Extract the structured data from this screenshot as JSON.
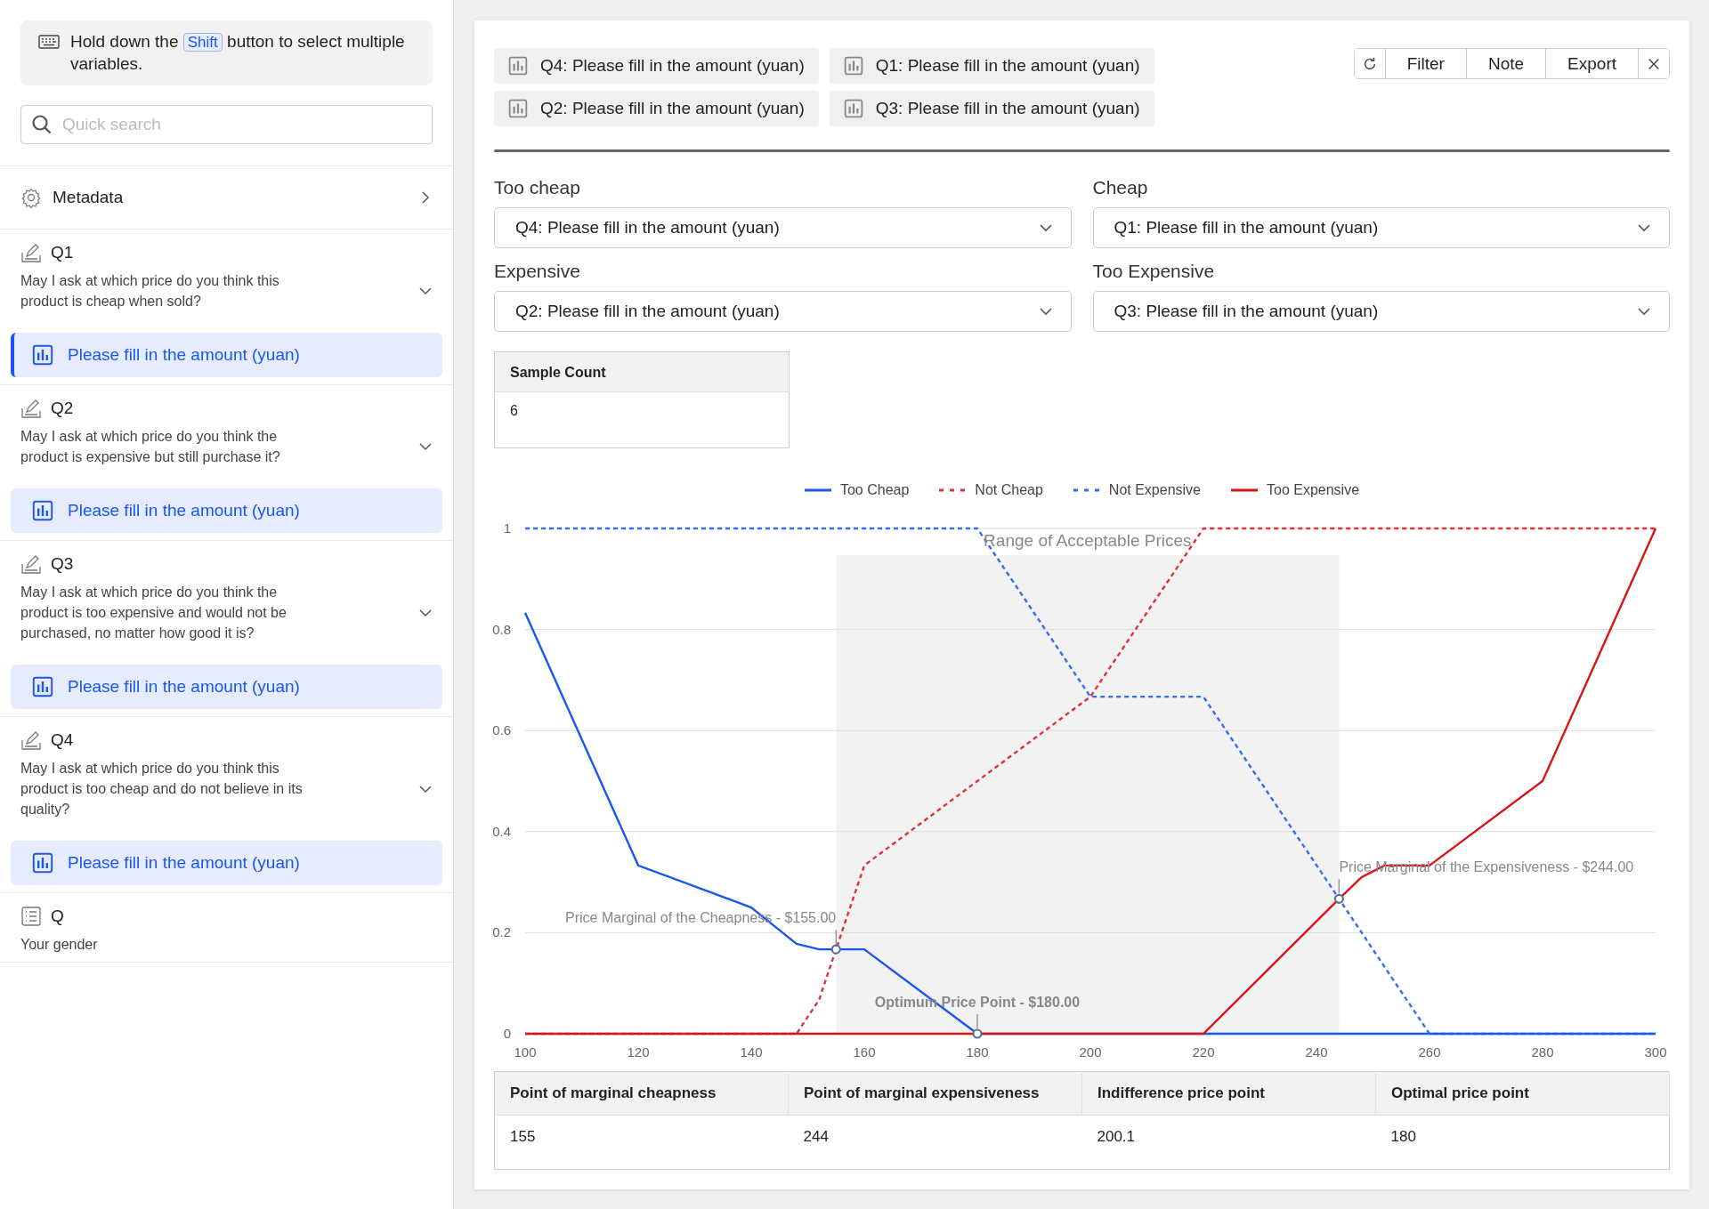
{
  "sidebar": {
    "hint": {
      "before": "Hold down the",
      "key": "Shift",
      "after": "button to select multiple variables."
    },
    "search": {
      "placeholder": "Quick search"
    },
    "items": [
      {
        "kind": "metadata",
        "label": "Metadata"
      },
      {
        "kind": "fill_in",
        "label": "Q1",
        "question": "May I ask at which price do you think this product is cheap when sold?",
        "variables": [
          {
            "label": "Please fill in the amount (yuan)",
            "selected": true
          }
        ]
      },
      {
        "kind": "fill_in",
        "label": "Q2",
        "question": "May I ask at which price do you think the product is expensive but still purchase it?",
        "variables": [
          {
            "label": "Please fill in the amount (yuan)",
            "selected": false
          }
        ]
      },
      {
        "kind": "fill_in",
        "label": "Q3",
        "question": "May I ask at which price do you think the product is too expensive and would not be purchased, no matter how good it is?",
        "variables": [
          {
            "label": "Please fill in the amount (yuan)",
            "selected": false
          }
        ]
      },
      {
        "kind": "fill_in",
        "label": "Q4",
        "question": "May I ask at which price do you think this product is too cheap and do not believe in its quality?",
        "variables": [
          {
            "label": "Please fill in the amount (yuan)",
            "selected": false
          }
        ]
      },
      {
        "kind": "choice",
        "label": "Q",
        "question": "Your gender"
      }
    ]
  },
  "main": {
    "selected_variables": [
      "Q4: Please fill in the amount (yuan)",
      "Q1: Please fill in the amount (yuan)",
      "Q2: Please fill in the amount (yuan)",
      "Q3: Please fill in the amount (yuan)"
    ],
    "toolbar": [
      "Filter",
      "Note",
      "Export"
    ],
    "mappings": [
      {
        "label": "Too cheap",
        "value": "Q4: Please fill in the amount (yuan)"
      },
      {
        "label": "Cheap",
        "value": "Q1: Please fill in the amount (yuan)"
      },
      {
        "label": "Expensive",
        "value": "Q2: Please fill in the amount (yuan)"
      },
      {
        "label": "Too Expensive",
        "value": "Q3: Please fill in the amount (yuan)"
      }
    ],
    "sample_table": {
      "columns": [
        "Sample Count"
      ],
      "rows": [
        [
          "6"
        ]
      ]
    },
    "chart": {
      "chart_data": {
        "type": "line",
        "x": [
          100,
          120,
          140,
          148,
          152,
          155,
          160,
          180,
          200,
          220,
          244,
          248,
          252,
          260,
          280,
          300
        ],
        "series": [
          {
            "name": "Too Cheap",
            "color": "#1a56f0",
            "line_style": "solid",
            "values": [
              0.833,
              0.333,
              0.25,
              0.178,
              0.167,
              0.167,
              0.167,
              0,
              0,
              0,
              0,
              0,
              0,
              0,
              0,
              0
            ]
          },
          {
            "name": "Not Cheap",
            "color": "#e0323a",
            "line_style": "dashed",
            "values": [
              0,
              0,
              0,
              0,
              0.067,
              0.167,
              0.333,
              0.5,
              0.667,
              1,
              1,
              1,
              1,
              1,
              1,
              1
            ]
          },
          {
            "name": "Not Expensive",
            "color": "#2f6ef5",
            "line_style": "dashed",
            "values": [
              1,
              1,
              1,
              1,
              1,
              1,
              1,
              1,
              0.667,
              0.667,
              0.267,
              0.2,
              0.133,
              0,
              0,
              0
            ]
          },
          {
            "name": "Too Expensive",
            "color": "#d91414",
            "line_style": "solid",
            "values": [
              0,
              0,
              0,
              0,
              0,
              0,
              0,
              0,
              0,
              0,
              0.267,
              0.31,
              0.333,
              0.333,
              0.5,
              1
            ]
          }
        ],
        "xlim": [
          100,
          300
        ],
        "ylim": [
          0,
          1
        ],
        "xticks": [
          100,
          120,
          140,
          160,
          180,
          200,
          220,
          240,
          260,
          280,
          300
        ],
        "yticks": [
          0,
          0.2,
          0.4,
          0.6,
          0.8,
          1
        ],
        "grid": true,
        "bands": [
          {
            "axis": "x",
            "from": 155,
            "to": 244,
            "label": "Range of Acceptable Prices"
          }
        ],
        "annotations": [
          {
            "x": 155,
            "y": 0.167,
            "text": "Price Marginal of the Cheapness - $155.00"
          },
          {
            "x": 180,
            "y": 0,
            "text": "Optimum Price Point - $180.00"
          },
          {
            "x": 244,
            "y": 0.267,
            "text": "Price Marginal of the Expensiveness - $244.00"
          }
        ]
      }
    },
    "results_table": {
      "columns": [
        "Point of marginal cheapness",
        "Point of marginal expensiveness",
        "Indifference price point",
        "Optimal price point"
      ],
      "rows": [
        [
          "155",
          "244",
          "200.1",
          "180"
        ]
      ]
    }
  }
}
